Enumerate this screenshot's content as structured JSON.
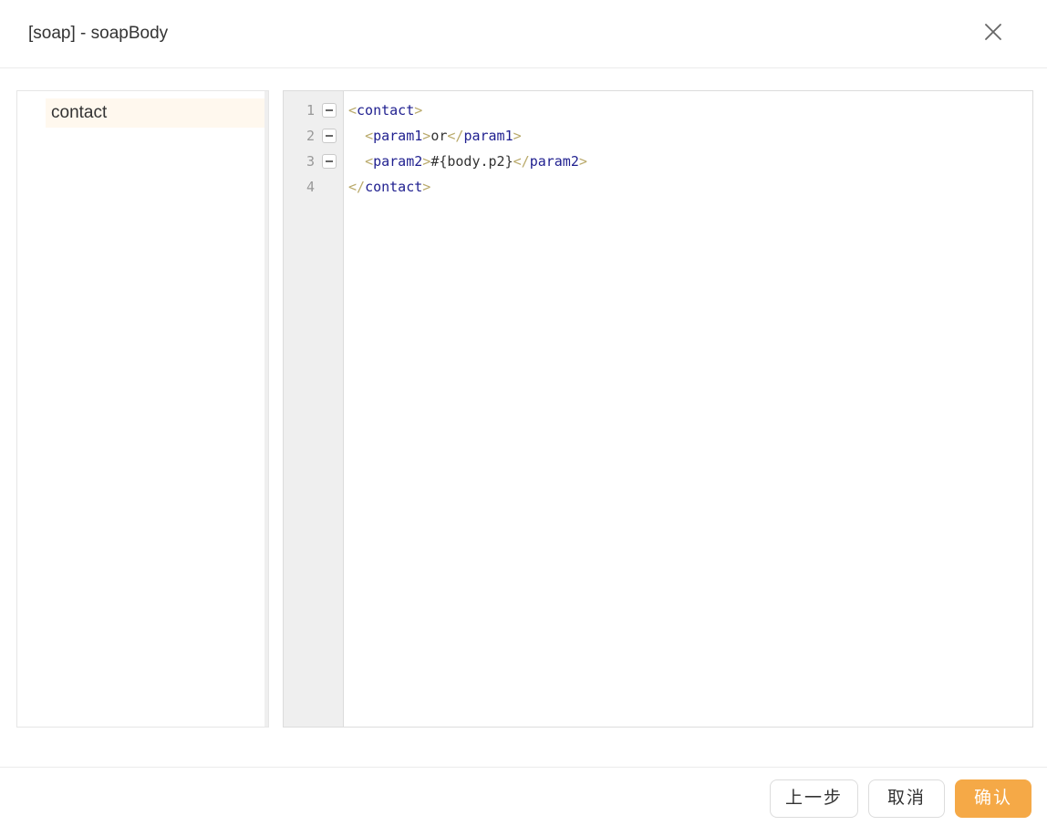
{
  "dialog": {
    "title": "[soap] - soapBody"
  },
  "tree": {
    "nodes": [
      {
        "label": "contact",
        "selected": true
      }
    ]
  },
  "editor": {
    "lines": [
      {
        "number": "1",
        "foldable": true,
        "tokens": [
          [
            "b",
            "<"
          ],
          [
            "t",
            "contact"
          ],
          [
            "b",
            ">"
          ]
        ]
      },
      {
        "number": "2",
        "foldable": true,
        "tokens": [
          [
            "v",
            "  "
          ],
          [
            "b",
            "<"
          ],
          [
            "t",
            "param1"
          ],
          [
            "b",
            ">"
          ],
          [
            "v",
            "or"
          ],
          [
            "b",
            "</"
          ],
          [
            "t",
            "param1"
          ],
          [
            "b",
            ">"
          ]
        ]
      },
      {
        "number": "3",
        "foldable": true,
        "tokens": [
          [
            "v",
            "  "
          ],
          [
            "b",
            "<"
          ],
          [
            "t",
            "param2"
          ],
          [
            "b",
            ">"
          ],
          [
            "v",
            "#{body.p2}"
          ],
          [
            "b",
            "</"
          ],
          [
            "t",
            "param2"
          ],
          [
            "b",
            ">"
          ]
        ]
      },
      {
        "number": "4",
        "foldable": false,
        "tokens": [
          [
            "b",
            "</"
          ],
          [
            "t",
            "contact"
          ],
          [
            "b",
            ">"
          ]
        ]
      }
    ]
  },
  "footer": {
    "prev_label": "上一步",
    "cancel_label": "取消",
    "confirm_label": "确认"
  },
  "colors": {
    "accent": "#f5a947",
    "selected_bg": "#fff8ee",
    "tag_name": "#1f1f8f",
    "tag_bracket": "#b9a96a"
  },
  "icons": {
    "close": "close-icon",
    "fold": "fold-toggle-icon"
  }
}
